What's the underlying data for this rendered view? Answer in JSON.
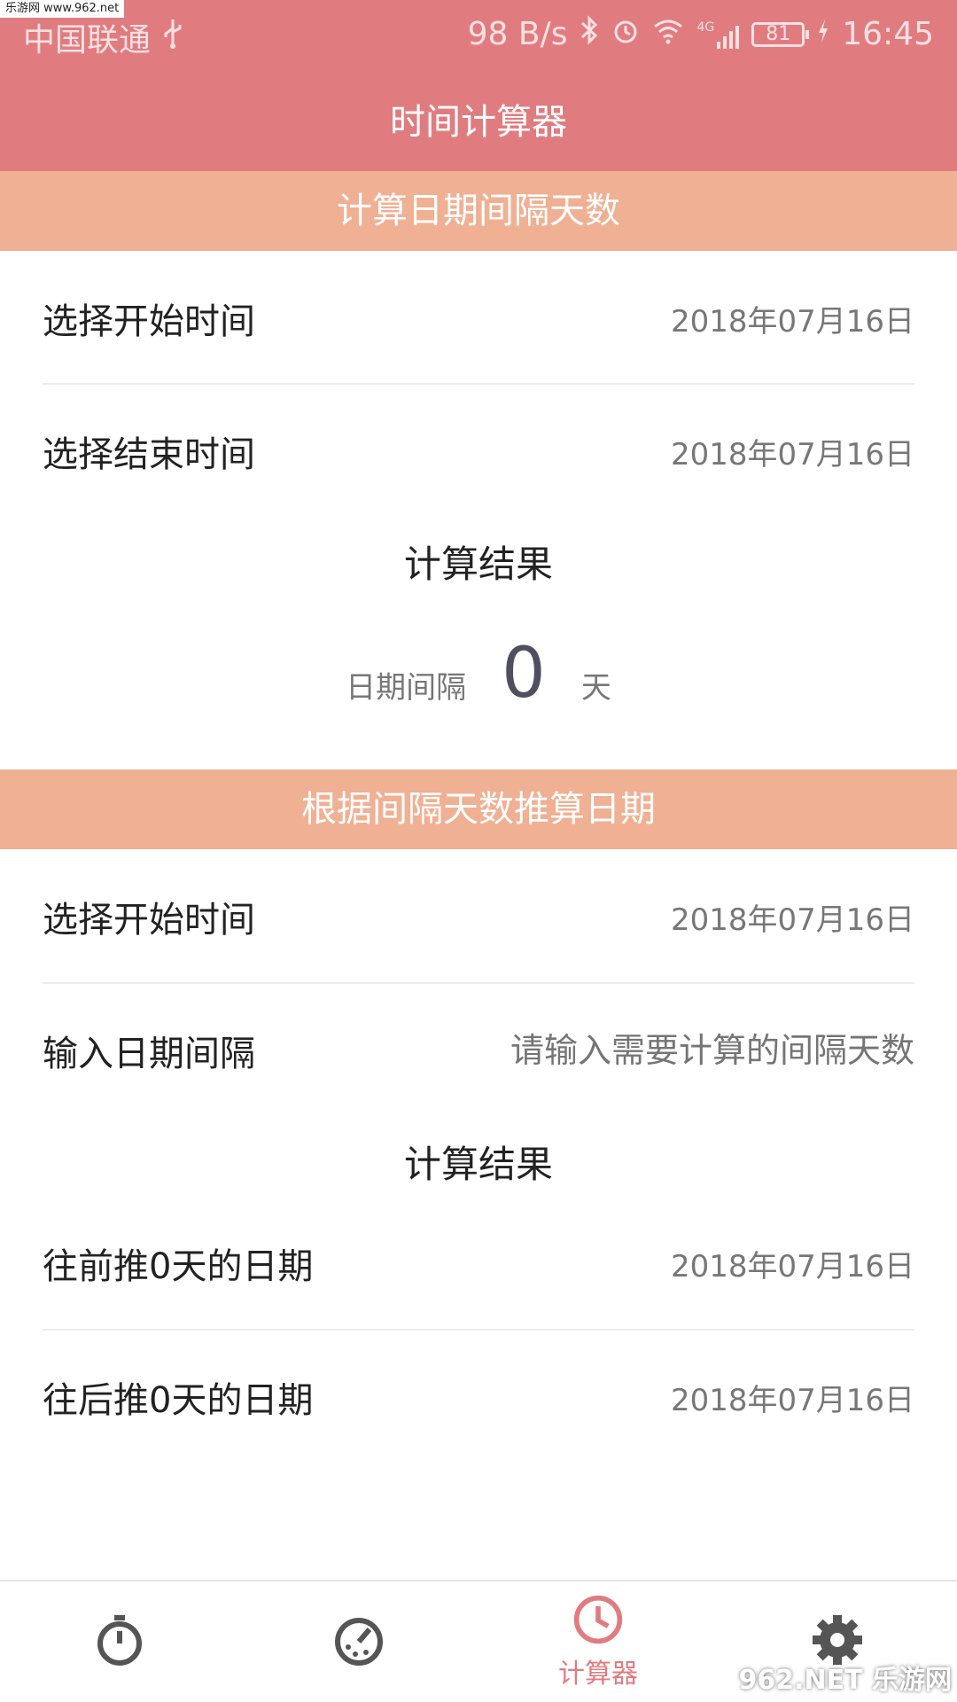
{
  "watermark_top": "乐游网 www.962.net",
  "status_bar": {
    "carrier": "中国联通",
    "net_speed": "98 B/s",
    "network": "4G",
    "battery": "81",
    "time": "16:45"
  },
  "app_title": "时间计算器",
  "section1": {
    "title": "计算日期间隔天数",
    "start_label": "选择开始时间",
    "start_value": "2018年07月16日",
    "end_label": "选择结束时间",
    "end_value": "2018年07月16日",
    "result_title": "计算结果",
    "interval_prefix": "日期间隔",
    "interval_value": "0",
    "interval_suffix": "天"
  },
  "section2": {
    "title": "根据间隔天数推算日期",
    "start_label": "选择开始时间",
    "start_value": "2018年07月16日",
    "interval_label": "输入日期间隔",
    "interval_placeholder": "请输入需要计算的间隔天数",
    "result_title": "计算结果",
    "before_label": "往前推0天的日期",
    "before_value": "2018年07月16日",
    "after_label": "往后推0天的日期",
    "after_value": "2018年07月16日"
  },
  "tabs": [
    {
      "icon": "stopwatch-icon",
      "label": ""
    },
    {
      "icon": "timer-dial-icon",
      "label": ""
    },
    {
      "icon": "clock-icon",
      "label": "计算器",
      "active": true
    },
    {
      "icon": "gear-icon",
      "label": ""
    }
  ],
  "colors": {
    "header": "#e07c80",
    "section_bar": "#f0b093",
    "active_tab": "#e07c80",
    "inactive_icon": "#555555"
  },
  "watermark_bottom": "962.NET 乐游网"
}
